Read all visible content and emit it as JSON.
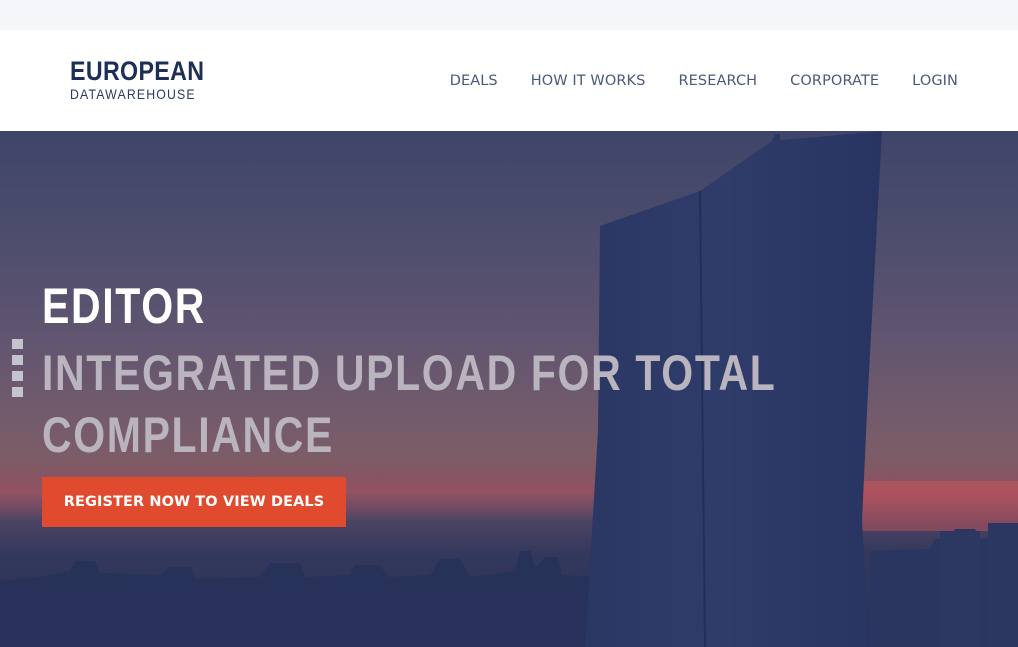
{
  "header": {
    "logo": {
      "line1": "EUROPEAN",
      "line2": "DATAWAREHOUSE"
    },
    "nav": [
      {
        "label": "DEALS"
      },
      {
        "label": "HOW IT WORKS"
      },
      {
        "label": "RESEARCH"
      },
      {
        "label": "CORPORATE"
      },
      {
        "label": "LOGIN"
      }
    ]
  },
  "hero": {
    "eyebrow": "EDITOR",
    "headline": "INTEGRATED UPLOAD FOR TOTAL COMPLIANCE",
    "cta_label": "REGISTER NOW TO VIEW DEALS",
    "slide_count": 4
  },
  "colors": {
    "brand_navy": "#1d2f57",
    "nav_text": "#4a5a78",
    "cta": "#e04a2e",
    "headline_muted": "#b9b4be"
  }
}
